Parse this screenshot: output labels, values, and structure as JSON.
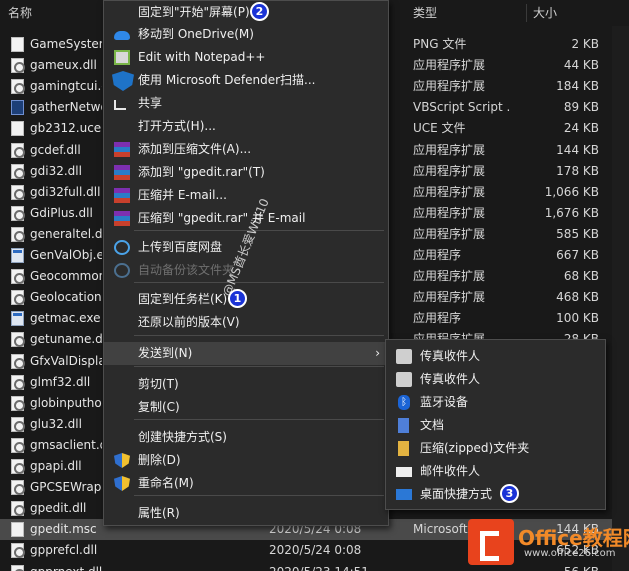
{
  "columns": {
    "name": "名称",
    "type": "类型",
    "size": "大小"
  },
  "files": [
    {
      "name": "GameSystem",
      "icon": "image-file-icon",
      "date": "",
      "type": "PNG 文件",
      "size": "2 KB"
    },
    {
      "name": "gameux.dll",
      "icon": "dll-file-icon",
      "date": "",
      "type": "应用程序扩展",
      "size": "44 KB"
    },
    {
      "name": "gamingtcui.d",
      "icon": "dll-file-icon",
      "date": "",
      "type": "应用程序扩展",
      "size": "184 KB"
    },
    {
      "name": "gatherNetwo",
      "icon": "vbs-file-icon",
      "date": "",
      "type": "VBScript Script ...",
      "size": "89 KB"
    },
    {
      "name": "gb2312.uce",
      "icon": "generic-file-icon",
      "date": "",
      "type": "UCE 文件",
      "size": "24 KB"
    },
    {
      "name": "gcdef.dll",
      "icon": "dll-file-icon",
      "date": "",
      "type": "应用程序扩展",
      "size": "144 KB"
    },
    {
      "name": "gdi32.dll",
      "icon": "dll-file-icon",
      "date": "",
      "type": "应用程序扩展",
      "size": "178 KB"
    },
    {
      "name": "gdi32full.dll",
      "icon": "dll-file-icon",
      "date": "",
      "type": "应用程序扩展",
      "size": "1,066 KB"
    },
    {
      "name": "GdiPlus.dll",
      "icon": "dll-file-icon",
      "date": "",
      "type": "应用程序扩展",
      "size": "1,676 KB"
    },
    {
      "name": "generaltel.dll",
      "icon": "dll-file-icon",
      "date": "",
      "type": "应用程序扩展",
      "size": "585 KB"
    },
    {
      "name": "GenValObj.ex",
      "icon": "exe-file-icon",
      "date": "",
      "type": "应用程序",
      "size": "667 KB"
    },
    {
      "name": "Geocommon",
      "icon": "dll-file-icon",
      "date": "",
      "type": "应用程序扩展",
      "size": "68 KB"
    },
    {
      "name": "Geolocation.",
      "icon": "dll-file-icon",
      "date": "",
      "type": "应用程序扩展",
      "size": "468 KB"
    },
    {
      "name": "getmac.exe",
      "icon": "exe-file-icon",
      "date": "",
      "type": "应用程序",
      "size": "100 KB"
    },
    {
      "name": "getuname.dll",
      "icon": "dll-file-icon",
      "date": "",
      "type": "应用程序扩展",
      "size": "28 KB"
    },
    {
      "name": "GfxValDispla",
      "icon": "dll-file-icon",
      "date": "",
      "type": "",
      "size": ""
    },
    {
      "name": "glmf32.dll",
      "icon": "dll-file-icon",
      "date": "",
      "type": "",
      "size": ""
    },
    {
      "name": "globinputhos",
      "icon": "dll-file-icon",
      "date": "",
      "type": "",
      "size": ""
    },
    {
      "name": "glu32.dll",
      "icon": "dll-file-icon",
      "date": "",
      "type": "",
      "size": ""
    },
    {
      "name": "gmsaclient.d",
      "icon": "dll-file-icon",
      "date": "",
      "type": "",
      "size": ""
    },
    {
      "name": "gpapi.dll",
      "icon": "dll-file-icon",
      "date": "",
      "type": "",
      "size": ""
    },
    {
      "name": "GPCSEWrapp",
      "icon": "dll-file-icon",
      "date": "",
      "type": "",
      "size": ""
    },
    {
      "name": "gpedit.dll",
      "icon": "dll-file-icon",
      "date": "",
      "type": "",
      "size": ""
    },
    {
      "name": "gpedit.msc",
      "icon": "msc-file-icon",
      "date": "2020/5/24 0:08",
      "type": "Microsoft 通用管",
      "size": "144 KB",
      "selected": true
    },
    {
      "name": "gpprefcl.dll",
      "icon": "dll-file-icon",
      "date": "2020/5/24 0:08",
      "type": "",
      "size": "652 KB"
    },
    {
      "name": "gpprnext.dll",
      "icon": "dll-file-icon",
      "date": "2020/5/23 14:51",
      "type": "",
      "size": "56 KB"
    }
  ],
  "context_menu": {
    "items": [
      {
        "label": "固定到\"开始\"屏幕(P)",
        "icon": "",
        "badge": "2"
      },
      {
        "label": "移动到 OneDrive(M)",
        "icon": "onedrive-icon"
      },
      {
        "label": "Edit with Notepad++",
        "icon": "notepad-plus-plus-icon"
      },
      {
        "label": "使用 Microsoft Defender扫描...",
        "icon": "defender-shield-icon"
      },
      {
        "label": "共享",
        "icon": "share-icon"
      },
      {
        "label": "打开方式(H)...",
        "icon": ""
      },
      {
        "label": "添加到压缩文件(A)...",
        "icon": "winrar-icon"
      },
      {
        "label": "添加到 \"gpedit.rar\"(T)",
        "icon": "winrar-icon"
      },
      {
        "label": "压缩并 E-mail...",
        "icon": "winrar-icon"
      },
      {
        "label": "压缩到 \"gpedit.rar\" 并 E-mail",
        "icon": "winrar-icon"
      },
      {
        "label": "上传到百度网盘",
        "icon": "baidu-netdisk-icon"
      },
      {
        "label": "自动备份该文件夹",
        "icon": "baidu-netdisk-icon",
        "disabled": true
      },
      {
        "label": "固定到任务栏(K)",
        "icon": "",
        "badge": "1"
      },
      {
        "label": "还原以前的版本(V)",
        "icon": ""
      },
      {
        "label": "发送到(N)",
        "icon": "",
        "submenu": true,
        "hover": true
      },
      {
        "label": "剪切(T)",
        "icon": ""
      },
      {
        "label": "复制(C)",
        "icon": ""
      },
      {
        "label": "创建快捷方式(S)",
        "icon": ""
      },
      {
        "label": "删除(D)",
        "icon": "uac-shield-icon"
      },
      {
        "label": "重命名(M)",
        "icon": "uac-shield-icon"
      },
      {
        "label": "属性(R)",
        "icon": ""
      }
    ],
    "submenu_arrow": "›"
  },
  "send_to_menu": {
    "items": [
      {
        "label": "传真收件人",
        "icon": "fax-icon"
      },
      {
        "label": "传真收件人",
        "icon": "fax-icon"
      },
      {
        "label": "蓝牙设备",
        "icon": "bluetooth-icon"
      },
      {
        "label": "文档",
        "icon": "document-icon"
      },
      {
        "label": "压缩(zipped)文件夹",
        "icon": "zip-folder-icon"
      },
      {
        "label": "邮件收件人",
        "icon": "mail-icon"
      },
      {
        "label": "桌面快捷方式",
        "icon": "desktop-icon",
        "badge": "3"
      }
    ]
  },
  "watermark": "@MS酋长爱Win10",
  "logo": {
    "text": "Office教程网",
    "url": "www.office26.com"
  },
  "colors": {
    "menu_bg": "#2b2b2b",
    "badge": "#1a33d6",
    "selection": "#4a4a4a",
    "logo": "#e8431d"
  }
}
